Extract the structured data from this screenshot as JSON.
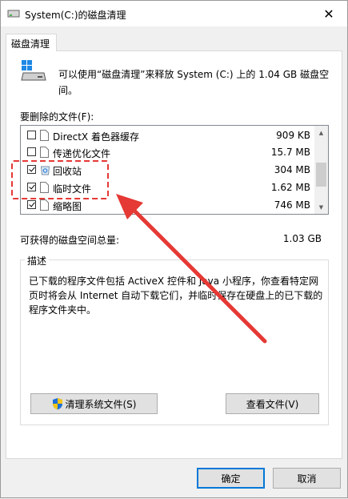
{
  "window": {
    "title": "System(C:)的磁盘清理",
    "close_glyph": "✕"
  },
  "tabs": [
    {
      "label": "磁盘清理"
    }
  ],
  "intro_text": "可以使用“磁盘清理”来释放 System (C:) 上的 1.04 GB 磁盘空间。",
  "files_label": "要删除的文件(F):",
  "files": [
    {
      "name": "DirectX 着色器缓存",
      "size": "909 KB",
      "checked": false,
      "icon": "file-icon"
    },
    {
      "name": "传递优化文件",
      "size": "15.7 MB",
      "checked": false,
      "icon": "file-icon"
    },
    {
      "name": "回收站",
      "size": "304 MB",
      "checked": true,
      "icon": "recycle-bin-icon"
    },
    {
      "name": "临时文件",
      "size": "1.62 MB",
      "checked": true,
      "icon": "file-icon"
    },
    {
      "name": "缩略图",
      "size": "746 MB",
      "checked": true,
      "icon": "file-icon"
    }
  ],
  "gain": {
    "label": "可获得的磁盘空间总量:",
    "value": "1.03 GB"
  },
  "description": {
    "title": "描述",
    "text": "已下载的程序文件包括 ActiveX 控件和 Java 小程序，你查看特定网页时将会从 Internet 自动下载它们，并临时保存在硬盘上的已下载的程序文件夹中。"
  },
  "buttons": {
    "clean_system": "清理系统文件(S)",
    "view_files": "查看文件(V)",
    "ok": "确定",
    "cancel": "取消"
  },
  "colors": {
    "annotation_red": "#e53935",
    "focus_blue": "#0078d7",
    "shield_blue": "#1e6fd9",
    "shield_yellow": "#f5c518"
  }
}
